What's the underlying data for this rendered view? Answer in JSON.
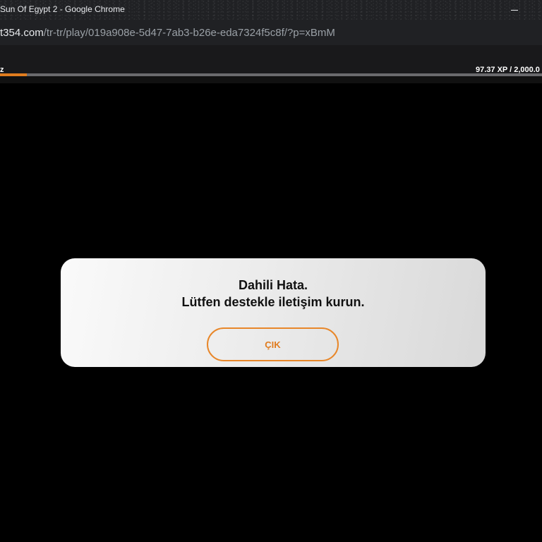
{
  "window": {
    "title": "Sun Of Egypt 2 - Google Chrome"
  },
  "address_bar": {
    "url_host": "t354.com",
    "url_path": "/tr-tr/play/019a908e-5d47-7ab3-b26e-eda7324f5c8f/?p=xBmM"
  },
  "game_header": {
    "left_label": "z",
    "xp_text": "97.37 XP / 2,000.0",
    "xp_progress_fraction": 0.05
  },
  "dialog": {
    "line1": "Dahili Hata.",
    "line2": "Lütfen destekle iletişim kurun.",
    "exit_label": "ÇIK"
  },
  "colors": {
    "accent": "#e07c1f",
    "background": "#000000"
  }
}
